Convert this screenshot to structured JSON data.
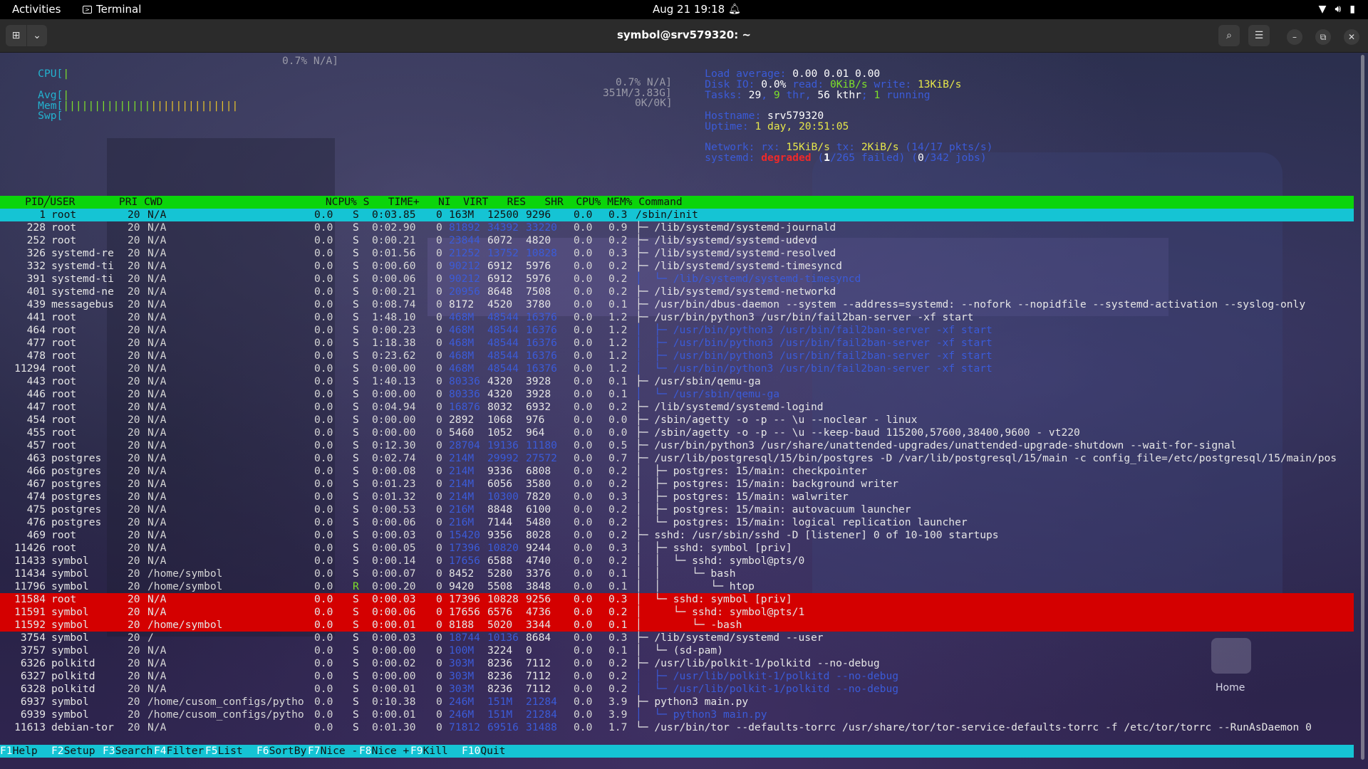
{
  "topbar": {
    "activities": "Activities",
    "app_name": "Terminal",
    "clock": "Aug 21  19:18"
  },
  "window": {
    "title": "symbol@srv579320: ~"
  },
  "meters": {
    "cpu_label": "CPU[",
    "cpu_bar": "|",
    "cpu_value": "0.7% N/A]",
    "avg_label": "Avg[",
    "avg_bar": "|",
    "avg_value": "0.7% N/A]",
    "mem_label": "Mem[",
    "mem_bar_green": "||||||||||||||",
    "mem_bar_yellow": "||||||||||||||",
    "mem_value": "351M/3.83G]",
    "swp_label": "Swp[",
    "swp_value": "0K/0K]"
  },
  "info": {
    "load_label": "Load average:",
    "load_value": "0.00 0.01 0.00",
    "disk_label": "Disk IO:",
    "disk_pct": "0.0%",
    "disk_read_label": "read:",
    "disk_read": "0KiB/s",
    "disk_write_label": "write:",
    "disk_write": "13KiB/s",
    "tasks_label": "Tasks:",
    "tasks_total": "29",
    "tasks_sep1": ",",
    "tasks_thr": "9",
    "tasks_thr_label": "thr,",
    "tasks_kthr": "56 kthr",
    "tasks_sep2": ";",
    "tasks_running": "1",
    "tasks_running_label": "running",
    "hostname_label": "Hostname:",
    "hostname": "srv579320",
    "uptime_label": "Uptime:",
    "uptime": "1 day, 20:51:05",
    "network_label": "Network:",
    "rx_label": "rx:",
    "rx": "15KiB/s",
    "tx_label": "tx:",
    "tx": "2KiB/s",
    "net_extra": "(14/17 pkts/s)",
    "systemd_label": "systemd:",
    "systemd_state": "degraded",
    "systemd_failed_open": "(",
    "systemd_failed": "1",
    "systemd_failed_of": "/265 failed)",
    "systemd_jobs_open": "(",
    "systemd_jobs": "0",
    "systemd_jobs_of": "/342 jobs)"
  },
  "table_header": "    PID╱USER       PRI CWD                          NCPU% S   TIME+   NI  VIRT   RES   SHR  CPU% MEM% Command",
  "processes": [
    {
      "pid": "1",
      "user": "root",
      "pri": "20",
      "cwd": "N/A",
      "ncpu": "0.0",
      "s": "S",
      "time": "0:03.85",
      "ni": "0",
      "virt": "163M",
      "res": "12500",
      "shr": "9296",
      "cpu": "0.0",
      "mem": "0.3",
      "cmd": "/sbin/init",
      "style": "cyan"
    },
    {
      "pid": "228",
      "user": "root",
      "pri": "20",
      "cwd": "N/A",
      "ncpu": "0.0",
      "s": "S",
      "time": "0:02.90",
      "ni": "0",
      "virt": "81892",
      "res": "34392",
      "shr": "33220",
      "cpu": "0.0",
      "mem": "0.9",
      "cmd": "├─ /lib/systemd/systemd-journald",
      "style": ""
    },
    {
      "pid": "252",
      "user": "root",
      "pri": "20",
      "cwd": "N/A",
      "ncpu": "0.0",
      "s": "S",
      "time": "0:00.21",
      "ni": "0",
      "virt": "23844",
      "res": "6072",
      "shr": "4820",
      "cpu": "0.0",
      "mem": "0.2",
      "cmd": "├─ /lib/systemd/systemd-udevd",
      "style": ""
    },
    {
      "pid": "326",
      "user": "systemd-re",
      "pri": "20",
      "cwd": "N/A",
      "ncpu": "0.0",
      "s": "S",
      "time": "0:01.56",
      "ni": "0",
      "virt": "21252",
      "res": "13752",
      "shr": "10828",
      "cpu": "0.0",
      "mem": "0.3",
      "cmd": "├─ /lib/systemd/systemd-resolved",
      "style": ""
    },
    {
      "pid": "332",
      "user": "systemd-ti",
      "pri": "20",
      "cwd": "N/A",
      "ncpu": "0.0",
      "s": "S",
      "time": "0:00.60",
      "ni": "0",
      "virt": "90212",
      "res": "6912",
      "shr": "5976",
      "cpu": "0.0",
      "mem": "0.2",
      "cmd": "├─ /lib/systemd/systemd-timesyncd",
      "style": ""
    },
    {
      "pid": "391",
      "user": "systemd-ti",
      "pri": "20",
      "cwd": "N/A",
      "ncpu": "0.0",
      "s": "S",
      "time": "0:00.06",
      "ni": "0",
      "virt": "90212",
      "res": "6912",
      "shr": "5976",
      "cpu": "0.0",
      "mem": "0.2",
      "cmd": "│  └─ /lib/systemd/systemd-timesyncd",
      "style": "thread"
    },
    {
      "pid": "401",
      "user": "systemd-ne",
      "pri": "20",
      "cwd": "N/A",
      "ncpu": "0.0",
      "s": "S",
      "time": "0:00.21",
      "ni": "0",
      "virt": "20956",
      "res": "8648",
      "shr": "7508",
      "cpu": "0.0",
      "mem": "0.2",
      "cmd": "├─ /lib/systemd/systemd-networkd",
      "style": ""
    },
    {
      "pid": "439",
      "user": "messagebus",
      "pri": "20",
      "cwd": "N/A",
      "ncpu": "0.0",
      "s": "S",
      "time": "0:08.74",
      "ni": "0",
      "virt": "8172",
      "res": "4520",
      "shr": "3780",
      "cpu": "0.0",
      "mem": "0.1",
      "cmd": "├─ /usr/bin/dbus-daemon --system --address=systemd: --nofork --nopidfile --systemd-activation --syslog-only",
      "style": ""
    },
    {
      "pid": "441",
      "user": "root",
      "pri": "20",
      "cwd": "N/A",
      "ncpu": "0.0",
      "s": "S",
      "time": "1:48.10",
      "ni": "0",
      "virt": "468M",
      "res": "48544",
      "shr": "16376",
      "cpu": "0.0",
      "mem": "1.2",
      "cmd": "├─ /usr/bin/python3 /usr/bin/fail2ban-server -xf start",
      "style": ""
    },
    {
      "pid": "464",
      "user": "root",
      "pri": "20",
      "cwd": "N/A",
      "ncpu": "0.0",
      "s": "S",
      "time": "0:00.23",
      "ni": "0",
      "virt": "468M",
      "res": "48544",
      "shr": "16376",
      "cpu": "0.0",
      "mem": "1.2",
      "cmd": "│  ├─ /usr/bin/python3 /usr/bin/fail2ban-server -xf start",
      "style": "thread"
    },
    {
      "pid": "477",
      "user": "root",
      "pri": "20",
      "cwd": "N/A",
      "ncpu": "0.0",
      "s": "S",
      "time": "1:18.38",
      "ni": "0",
      "virt": "468M",
      "res": "48544",
      "shr": "16376",
      "cpu": "0.0",
      "mem": "1.2",
      "cmd": "│  ├─ /usr/bin/python3 /usr/bin/fail2ban-server -xf start",
      "style": "thread"
    },
    {
      "pid": "478",
      "user": "root",
      "pri": "20",
      "cwd": "N/A",
      "ncpu": "0.0",
      "s": "S",
      "time": "0:23.62",
      "ni": "0",
      "virt": "468M",
      "res": "48544",
      "shr": "16376",
      "cpu": "0.0",
      "mem": "1.2",
      "cmd": "│  ├─ /usr/bin/python3 /usr/bin/fail2ban-server -xf start",
      "style": "thread"
    },
    {
      "pid": "11294",
      "user": "root",
      "pri": "20",
      "cwd": "N/A",
      "ncpu": "0.0",
      "s": "S",
      "time": "0:00.00",
      "ni": "0",
      "virt": "468M",
      "res": "48544",
      "shr": "16376",
      "cpu": "0.0",
      "mem": "1.2",
      "cmd": "│  └─ /usr/bin/python3 /usr/bin/fail2ban-server -xf start",
      "style": "thread"
    },
    {
      "pid": "443",
      "user": "root",
      "pri": "20",
      "cwd": "N/A",
      "ncpu": "0.0",
      "s": "S",
      "time": "1:40.13",
      "ni": "0",
      "virt": "80336",
      "res": "4320",
      "shr": "3928",
      "cpu": "0.0",
      "mem": "0.1",
      "cmd": "├─ /usr/sbin/qemu-ga",
      "style": ""
    },
    {
      "pid": "446",
      "user": "root",
      "pri": "20",
      "cwd": "N/A",
      "ncpu": "0.0",
      "s": "S",
      "time": "0:00.00",
      "ni": "0",
      "virt": "80336",
      "res": "4320",
      "shr": "3928",
      "cpu": "0.0",
      "mem": "0.1",
      "cmd": "│  └─ /usr/sbin/qemu-ga",
      "style": "thread"
    },
    {
      "pid": "447",
      "user": "root",
      "pri": "20",
      "cwd": "N/A",
      "ncpu": "0.0",
      "s": "S",
      "time": "0:04.94",
      "ni": "0",
      "virt": "16876",
      "res": "8032",
      "shr": "6932",
      "cpu": "0.0",
      "mem": "0.2",
      "cmd": "├─ /lib/systemd/systemd-logind",
      "style": ""
    },
    {
      "pid": "454",
      "user": "root",
      "pri": "20",
      "cwd": "N/A",
      "ncpu": "0.0",
      "s": "S",
      "time": "0:00.00",
      "ni": "0",
      "virt": "2892",
      "res": "1068",
      "shr": "976",
      "cpu": "0.0",
      "mem": "0.0",
      "cmd": "├─ /sbin/agetty -o -p -- \\u --noclear - linux",
      "style": ""
    },
    {
      "pid": "455",
      "user": "root",
      "pri": "20",
      "cwd": "N/A",
      "ncpu": "0.0",
      "s": "S",
      "time": "0:00.00",
      "ni": "0",
      "virt": "5460",
      "res": "1052",
      "shr": "964",
      "cpu": "0.0",
      "mem": "0.0",
      "cmd": "├─ /sbin/agetty -o -p -- \\u --keep-baud 115200,57600,38400,9600 - vt220",
      "style": ""
    },
    {
      "pid": "457",
      "user": "root",
      "pri": "20",
      "cwd": "N/A",
      "ncpu": "0.0",
      "s": "S",
      "time": "0:12.30",
      "ni": "0",
      "virt": "28704",
      "res": "19136",
      "shr": "11180",
      "cpu": "0.0",
      "mem": "0.5",
      "cmd": "├─ /usr/bin/python3 /usr/share/unattended-upgrades/unattended-upgrade-shutdown --wait-for-signal",
      "style": ""
    },
    {
      "pid": "463",
      "user": "postgres",
      "pri": "20",
      "cwd": "N/A",
      "ncpu": "0.0",
      "s": "S",
      "time": "0:02.74",
      "ni": "0",
      "virt": "214M",
      "res": "29992",
      "shr": "27572",
      "cpu": "0.0",
      "mem": "0.7",
      "cmd": "├─ /usr/lib/postgresql/15/bin/postgres -D /var/lib/postgresql/15/main -c config_file=/etc/postgresql/15/main/pos",
      "style": ""
    },
    {
      "pid": "466",
      "user": "postgres",
      "pri": "20",
      "cwd": "N/A",
      "ncpu": "0.0",
      "s": "S",
      "time": "0:00.08",
      "ni": "0",
      "virt": "214M",
      "res": "9336",
      "shr": "6808",
      "cpu": "0.0",
      "mem": "0.2",
      "cmd": "│  ├─ postgres: 15/main: checkpointer",
      "style": ""
    },
    {
      "pid": "467",
      "user": "postgres",
      "pri": "20",
      "cwd": "N/A",
      "ncpu": "0.0",
      "s": "S",
      "time": "0:01.23",
      "ni": "0",
      "virt": "214M",
      "res": "6056",
      "shr": "3580",
      "cpu": "0.0",
      "mem": "0.2",
      "cmd": "│  ├─ postgres: 15/main: background writer",
      "style": ""
    },
    {
      "pid": "474",
      "user": "postgres",
      "pri": "20",
      "cwd": "N/A",
      "ncpu": "0.0",
      "s": "S",
      "time": "0:01.32",
      "ni": "0",
      "virt": "214M",
      "res": "10300",
      "shr": "7820",
      "cpu": "0.0",
      "mem": "0.3",
      "cmd": "│  ├─ postgres: 15/main: walwriter",
      "style": ""
    },
    {
      "pid": "475",
      "user": "postgres",
      "pri": "20",
      "cwd": "N/A",
      "ncpu": "0.0",
      "s": "S",
      "time": "0:00.53",
      "ni": "0",
      "virt": "216M",
      "res": "8848",
      "shr": "6100",
      "cpu": "0.0",
      "mem": "0.2",
      "cmd": "│  ├─ postgres: 15/main: autovacuum launcher",
      "style": ""
    },
    {
      "pid": "476",
      "user": "postgres",
      "pri": "20",
      "cwd": "N/A",
      "ncpu": "0.0",
      "s": "S",
      "time": "0:00.06",
      "ni": "0",
      "virt": "216M",
      "res": "7144",
      "shr": "5480",
      "cpu": "0.0",
      "mem": "0.2",
      "cmd": "│  └─ postgres: 15/main: logical replication launcher",
      "style": ""
    },
    {
      "pid": "469",
      "user": "root",
      "pri": "20",
      "cwd": "N/A",
      "ncpu": "0.0",
      "s": "S",
      "time": "0:00.03",
      "ni": "0",
      "virt": "15420",
      "res": "9356",
      "shr": "8028",
      "cpu": "0.0",
      "mem": "0.2",
      "cmd": "├─ sshd: /usr/sbin/sshd -D [listener] 0 of 10-100 startups",
      "style": ""
    },
    {
      "pid": "11426",
      "user": "root",
      "pri": "20",
      "cwd": "N/A",
      "ncpu": "0.0",
      "s": "S",
      "time": "0:00.05",
      "ni": "0",
      "virt": "17396",
      "res": "10820",
      "shr": "9244",
      "cpu": "0.0",
      "mem": "0.3",
      "cmd": "│  ├─ sshd: symbol [priv]",
      "style": ""
    },
    {
      "pid": "11433",
      "user": "symbol",
      "pri": "20",
      "cwd": "N/A",
      "ncpu": "0.0",
      "s": "S",
      "time": "0:00.14",
      "ni": "0",
      "virt": "17656",
      "res": "6588",
      "shr": "4740",
      "cpu": "0.0",
      "mem": "0.2",
      "cmd": "│  │  └─ sshd: symbol@pts/0",
      "style": ""
    },
    {
      "pid": "11434",
      "user": "symbol",
      "pri": "20",
      "cwd": "/home/symbol",
      "ncpu": "0.0",
      "s": "S",
      "time": "0:00.07",
      "ni": "0",
      "virt": "8452",
      "res": "5280",
      "shr": "3376",
      "cpu": "0.0",
      "mem": "0.1",
      "cmd": "│  │     └─ bash",
      "style": ""
    },
    {
      "pid": "11796",
      "user": "symbol",
      "pri": "20",
      "cwd": "/home/symbol",
      "ncpu": "0.0",
      "s": "R",
      "time": "0:00.20",
      "ni": "0",
      "virt": "9420",
      "res": "5508",
      "shr": "3848",
      "cpu": "0.0",
      "mem": "0.1",
      "cmd": "│  │        └─ htop",
      "style": ""
    },
    {
      "pid": "11584",
      "user": "root",
      "pri": "20",
      "cwd": "N/A",
      "ncpu": "0.0",
      "s": "S",
      "time": "0:00.03",
      "ni": "0",
      "virt": "17396",
      "res": "10828",
      "shr": "9256",
      "cpu": "0.0",
      "mem": "0.3",
      "cmd": "│  └─ sshd: symbol [priv]",
      "style": "red"
    },
    {
      "pid": "11591",
      "user": "symbol",
      "pri": "20",
      "cwd": "N/A",
      "ncpu": "0.0",
      "s": "S",
      "time": "0:00.06",
      "ni": "0",
      "virt": "17656",
      "res": "6576",
      "shr": "4736",
      "cpu": "0.0",
      "mem": "0.2",
      "cmd": "│     └─ sshd: symbol@pts/1",
      "style": "red"
    },
    {
      "pid": "11592",
      "user": "symbol",
      "pri": "20",
      "cwd": "/home/symbol",
      "ncpu": "0.0",
      "s": "S",
      "time": "0:00.01",
      "ni": "0",
      "virt": "8188",
      "res": "5020",
      "shr": "3344",
      "cpu": "0.0",
      "mem": "0.1",
      "cmd": "│        └─ -bash",
      "style": "red"
    },
    {
      "pid": "3754",
      "user": "symbol",
      "pri": "20",
      "cwd": "/",
      "ncpu": "0.0",
      "s": "S",
      "time": "0:00.03",
      "ni": "0",
      "virt": "18744",
      "res": "10136",
      "shr": "8684",
      "cpu": "0.0",
      "mem": "0.3",
      "cmd": "├─ /lib/systemd/systemd --user",
      "style": ""
    },
    {
      "pid": "3757",
      "user": "symbol",
      "pri": "20",
      "cwd": "N/A",
      "ncpu": "0.0",
      "s": "S",
      "time": "0:00.00",
      "ni": "0",
      "virt": "100M",
      "res": "3224",
      "shr": "0",
      "cpu": "0.0",
      "mem": "0.1",
      "cmd": "│  └─ (sd-pam)",
      "style": ""
    },
    {
      "pid": "6326",
      "user": "polkitd",
      "pri": "20",
      "cwd": "N/A",
      "ncpu": "0.0",
      "s": "S",
      "time": "0:00.02",
      "ni": "0",
      "virt": "303M",
      "res": "8236",
      "shr": "7112",
      "cpu": "0.0",
      "mem": "0.2",
      "cmd": "├─ /usr/lib/polkit-1/polkitd --no-debug",
      "style": ""
    },
    {
      "pid": "6327",
      "user": "polkitd",
      "pri": "20",
      "cwd": "N/A",
      "ncpu": "0.0",
      "s": "S",
      "time": "0:00.00",
      "ni": "0",
      "virt": "303M",
      "res": "8236",
      "shr": "7112",
      "cpu": "0.0",
      "mem": "0.2",
      "cmd": "│  ├─ /usr/lib/polkit-1/polkitd --no-debug",
      "style": "thread"
    },
    {
      "pid": "6328",
      "user": "polkitd",
      "pri": "20",
      "cwd": "N/A",
      "ncpu": "0.0",
      "s": "S",
      "time": "0:00.01",
      "ni": "0",
      "virt": "303M",
      "res": "8236",
      "shr": "7112",
      "cpu": "0.0",
      "mem": "0.2",
      "cmd": "│  └─ /usr/lib/polkit-1/polkitd --no-debug",
      "style": "thread"
    },
    {
      "pid": "6937",
      "user": "symbol",
      "pri": "20",
      "cwd": "/home/cusom_configs/pytho",
      "ncpu": "0.0",
      "s": "S",
      "time": "0:10.38",
      "ni": "0",
      "virt": "246M",
      "res": "151M",
      "shr": "21284",
      "cpu": "0.0",
      "mem": "3.9",
      "cmd": "├─ python3 main.py",
      "style": ""
    },
    {
      "pid": "6939",
      "user": "symbol",
      "pri": "20",
      "cwd": "/home/cusom_configs/pytho",
      "ncpu": "0.0",
      "s": "S",
      "time": "0:00.01",
      "ni": "0",
      "virt": "246M",
      "res": "151M",
      "shr": "21284",
      "cpu": "0.0",
      "mem": "3.9",
      "cmd": "│  └─ python3 main.py",
      "style": "thread"
    },
    {
      "pid": "11613",
      "user": "debian-tor",
      "pri": "20",
      "cwd": "N/A",
      "ncpu": "0.0",
      "s": "S",
      "time": "0:01.30",
      "ni": "0",
      "virt": "71812",
      "res": "69516",
      "shr": "31488",
      "cpu": "0.0",
      "mem": "1.7",
      "cmd": "└─ /usr/bin/tor --defaults-torrc /usr/share/tor/tor-service-defaults-torrc -f /etc/tor/torrc --RunAsDaemon 0",
      "style": ""
    }
  ],
  "fkeys": [
    {
      "key": "F1",
      "label": "Help  "
    },
    {
      "key": "F2",
      "label": "Setup "
    },
    {
      "key": "F3",
      "label": "Search"
    },
    {
      "key": "F4",
      "label": "Filter"
    },
    {
      "key": "F5",
      "label": "List  "
    },
    {
      "key": "F6",
      "label": "SortBy"
    },
    {
      "key": "F7",
      "label": "Nice -"
    },
    {
      "key": "F8",
      "label": "Nice +"
    },
    {
      "key": "F9",
      "label": "Kill  "
    },
    {
      "key": "F10",
      "label": "Quit  "
    }
  ],
  "desktop": {
    "home_label": "Home"
  },
  "colors": {
    "header_green": "#0bd40b",
    "selection_cyan": "#15c4d4",
    "tagged_red": "#d40000",
    "meter_cyan": "#23b3d0",
    "thread_blue": "#3b5bd8"
  }
}
